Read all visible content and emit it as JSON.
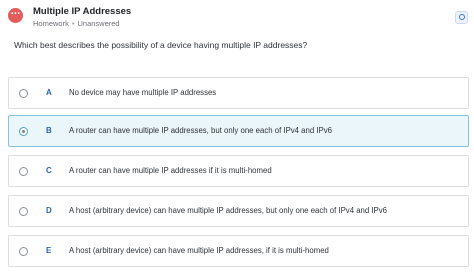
{
  "header": {
    "title": "Multiple IP Addresses",
    "category": "Homework",
    "status": "Unanswered",
    "avatar_icon": "ellipsis-icon",
    "corner_icon": "circle-icon"
  },
  "question": {
    "text": "Which best describes the possibility of a device having multiple IP addresses?"
  },
  "options": [
    {
      "letter": "A",
      "text": "No device may have multiple IP addresses",
      "selected": false
    },
    {
      "letter": "B",
      "text": "A router can have multiple IP addresses, but only one each of IPv4 and IPv6",
      "selected": true
    },
    {
      "letter": "C",
      "text": "A router can have multiple IP addresses if it is multi-homed",
      "selected": false
    },
    {
      "letter": "D",
      "text": "A host (arbitrary device) can have multiple IP addresses, but only one each of IPv4 and IPv6",
      "selected": false
    },
    {
      "letter": "E",
      "text": "A host (arbitrary device) can have multiple IP addresses, if it is multi-homed",
      "selected": false
    }
  ],
  "colors": {
    "accent": "#2a66b3",
    "selected_bg": "#eaf6fa",
    "selected_border": "#7fc4d8",
    "avatar": "#e35b5b"
  }
}
